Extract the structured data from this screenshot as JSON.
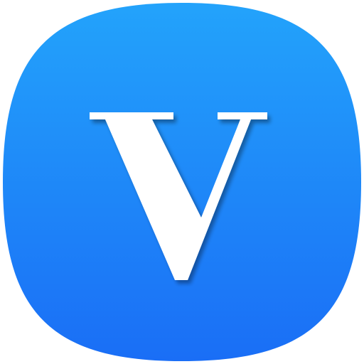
{
  "icon": {
    "name": "V",
    "glyph": "V",
    "colors": {
      "gradient_top": "#23A3FB",
      "gradient_bottom": "#1A6EF6",
      "glyph": "#FFFFFF",
      "background": "#FFFFFF"
    }
  }
}
